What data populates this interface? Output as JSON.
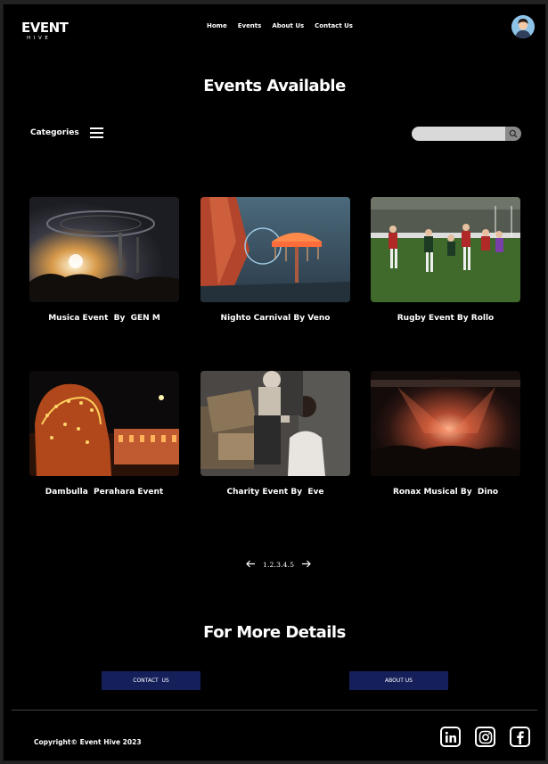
{
  "brand": {
    "name": "EVENT",
    "sub": "HIVE"
  },
  "nav": {
    "items": [
      "Home",
      "Events",
      "About Us",
      "Contact Us"
    ]
  },
  "page": {
    "title": "Events Available"
  },
  "toolbar": {
    "categories_label": "Categories",
    "search_placeholder": ""
  },
  "events": [
    {
      "title": "Musica Event  By  GEN M",
      "image": "concert-crowd-photo"
    },
    {
      "title": "Nighto Carnival By Veno",
      "image": "carnival-ride-photo"
    },
    {
      "title": "Rugby Event By Rollo",
      "image": "rugby-match-photo"
    },
    {
      "title": "Dambulla  Perahara Event",
      "image": "perahara-elephant-photo"
    },
    {
      "title": "Charity Event By  Eve",
      "image": "charity-boxes-photo"
    },
    {
      "title": "Ronax Musical By  Dino",
      "image": "stage-lights-photo"
    }
  ],
  "pagination": {
    "pages": "1.2.3.4.5"
  },
  "more": {
    "title": "For More Details",
    "contact_label": "CONTACT  US",
    "about_label": "ABOUT US"
  },
  "footer": {
    "copyright": "Copyright© Event Hive 2023"
  },
  "social": [
    "linkedin-icon",
    "instagram-icon",
    "facebook-icon"
  ],
  "colors": {
    "background": "#000000",
    "button": "#15205a",
    "search_field": "#d9d9d9",
    "search_button": "#8a8a8a"
  }
}
